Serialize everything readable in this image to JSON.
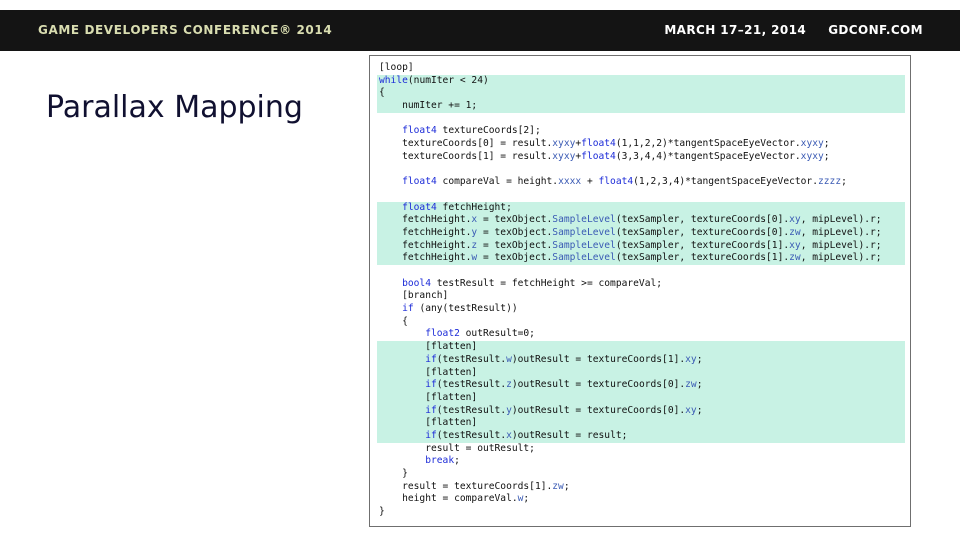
{
  "header": {
    "conference_name": "GAME DEVELOPERS CONFERENCE® 2014",
    "dates": "MARCH 17–21, 2014",
    "website": "GDCONF.COM"
  },
  "slide": {
    "title": "Parallax Mapping"
  },
  "code": {
    "language_hint": "HLSL",
    "highlighted_line_ranges": [
      [
        1,
        3
      ],
      [
        11,
        15
      ],
      [
        22,
        29
      ]
    ],
    "colors": {
      "highlight": "#c8f2e4",
      "keyword": "#1c2bd8",
      "swizzle": "#3a5ab4",
      "header_bar": "#141414",
      "conference_text": "#d9ddb0"
    },
    "lines": [
      "[loop]",
      "while(numIter < 24)",
      "{",
      "    numIter += 1;",
      "",
      "    float4 textureCoords[2];",
      "    textureCoords[0] = result.xyxy+float4(1,1,2,2)*tangentSpaceEyeVector.xyxy;",
      "    textureCoords[1] = result.xyxy+float4(3,3,4,4)*tangentSpaceEyeVector.xyxy;",
      "",
      "    float4 compareVal = height.xxxx + float4(1,2,3,4)*tangentSpaceEyeVector.zzzz;",
      "",
      "    float4 fetchHeight;",
      "    fetchHeight.x = texObject.SampleLevel(texSampler, textureCoords[0].xy, mipLevel).r;",
      "    fetchHeight.y = texObject.SampleLevel(texSampler, textureCoords[0].zw, mipLevel).r;",
      "    fetchHeight.z = texObject.SampleLevel(texSampler, textureCoords[1].xy, mipLevel).r;",
      "    fetchHeight.w = texObject.SampleLevel(texSampler, textureCoords[1].zw, mipLevel).r;",
      "",
      "    bool4 testResult = fetchHeight >= compareVal;",
      "    [branch]",
      "    if (any(testResult))",
      "    {",
      "        float2 outResult=0;",
      "        [flatten]",
      "        if(testResult.w)outResult = textureCoords[1].xy;",
      "        [flatten]",
      "        if(testResult.z)outResult = textureCoords[0].zw;",
      "        [flatten]",
      "        if(testResult.y)outResult = textureCoords[0].xy;",
      "        [flatten]",
      "        if(testResult.x)outResult = result;",
      "        result = outResult;",
      "        break;",
      "    }",
      "    result = textureCoords[1].zw;",
      "    height = compareVal.w;",
      "}"
    ]
  }
}
